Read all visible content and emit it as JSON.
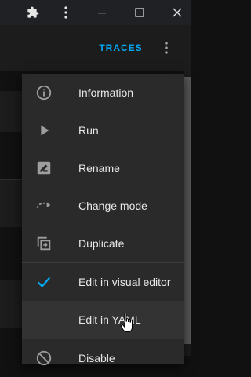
{
  "appbar": {
    "traces_label": "TRACES"
  },
  "menu": {
    "items": [
      {
        "label": "Information",
        "icon": "info-icon"
      },
      {
        "label": "Run",
        "icon": "play-icon"
      },
      {
        "label": "Rename",
        "icon": "rename-icon"
      },
      {
        "label": "Change mode",
        "icon": "change-mode-icon"
      },
      {
        "label": "Duplicate",
        "icon": "duplicate-icon"
      },
      {
        "label": "Edit in visual editor",
        "icon": "check-icon",
        "checked": true
      },
      {
        "label": "Edit in YAML",
        "icon": "",
        "hovered": true
      },
      {
        "label": "Disable",
        "icon": "disable-icon"
      }
    ]
  },
  "colors": {
    "accent": "#03a9f4",
    "menu_bg": "#2a2a2a",
    "text": "#e8e8e8",
    "icon": "#9e9e9e"
  }
}
